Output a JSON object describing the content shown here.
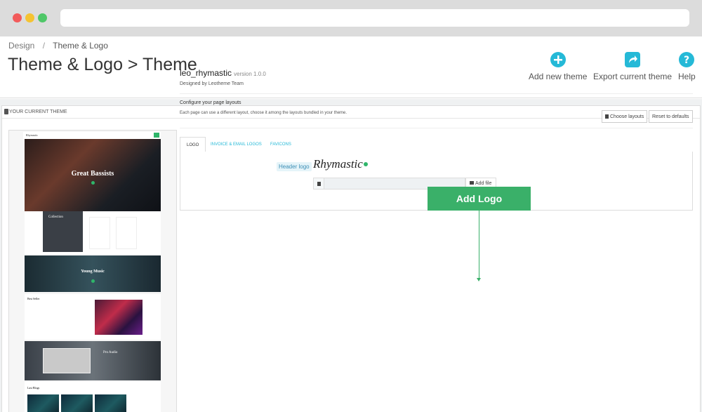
{
  "breadcrumb": {
    "parent": "Design",
    "separator": "/",
    "current": "Theme & Logo"
  },
  "page_title": "Theme & Logo > Theme",
  "toolbar": {
    "add_theme": "Add new theme",
    "export_theme": "Export current theme",
    "help": "Help"
  },
  "panel": {
    "heading": "YOUR CURRENT THEME"
  },
  "preview": {
    "logo": "Rhymastic",
    "hero_title": "Great Bassists",
    "collection": "Collection",
    "young_music": "Young Music",
    "best_seller": "Best Seller",
    "audio": "Pro Audio",
    "last_blogs": "Last Blogs"
  },
  "theme": {
    "name": "leo_rhymastic",
    "version": "version 1.0.0",
    "designed_by": "Designed by Leotheme Team"
  },
  "layouts": {
    "title": "Configure your page layouts",
    "description": "Each page can use a different layout, choose it among the layouts bundled in your theme.",
    "choose_button": "Choose layouts",
    "reset_button": "Reset to defaults"
  },
  "tabs": [
    {
      "label": "LOGO"
    },
    {
      "label": "INVOICE & EMAIL LOGOS"
    },
    {
      "label": "FAVICONS"
    }
  ],
  "logo_tab": {
    "header_logo_label": "Header logo",
    "logo_text": "Rhymastic",
    "file_value": "",
    "add_file_button": "Add file"
  },
  "callout": {
    "text": "Add Logo"
  },
  "colors": {
    "accent": "#25b9d7",
    "callout": "#3ab069",
    "brand_green": "#2fb56a"
  }
}
